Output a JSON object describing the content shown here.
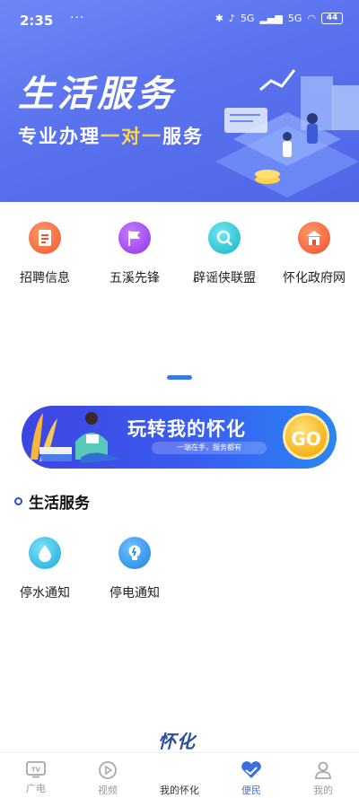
{
  "status_bar": {
    "time": "2:35",
    "dots": "···",
    "net1": "5G",
    "net2": "5G",
    "battery": "44"
  },
  "hero": {
    "title": "生活服务",
    "subtitle_pre": "专业办理",
    "subtitle_highlight": "一对一",
    "subtitle_post": "服务"
  },
  "quick_links": [
    {
      "label": "招聘信息",
      "icon": "document-icon",
      "color": "#f46a3a"
    },
    {
      "label": "五溪先锋",
      "icon": "flag-icon",
      "color": "#a24bf0"
    },
    {
      "label": "辟谣侠联盟",
      "icon": "search-icon",
      "color": "#28c8d8"
    },
    {
      "label": "怀化政府网",
      "icon": "government-building-icon",
      "color": "#f5613a"
    }
  ],
  "promo": {
    "title": "玩转我的怀化",
    "tagline": "一端在手，服务都有",
    "go_label": "GO"
  },
  "section": {
    "title": "生活服务"
  },
  "services": [
    {
      "label": "停水通知",
      "icon": "water-drop-icon",
      "color": "#29b9e8"
    },
    {
      "label": "停电通知",
      "icon": "lightbulb-icon",
      "color": "#2e8ee8"
    }
  ],
  "bottom_nav": {
    "tv": "广电",
    "video": "视频",
    "center": "我的怀化",
    "center_logo": "怀化",
    "services": "便民",
    "me": "我的",
    "active_color": "#3a6fe0"
  }
}
